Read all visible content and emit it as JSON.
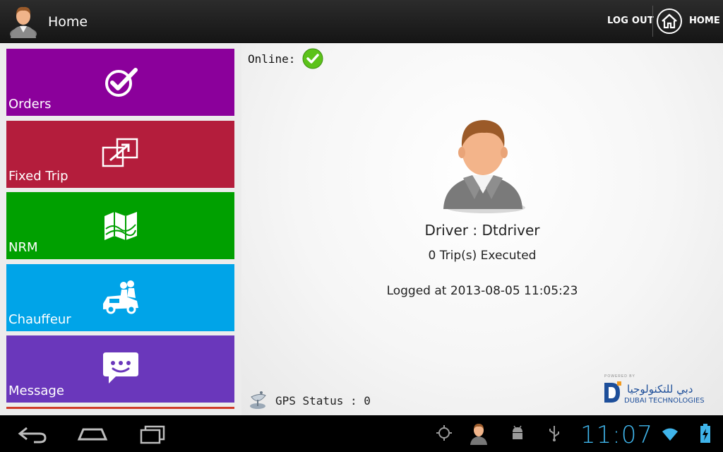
{
  "header": {
    "title": "Home",
    "logout_label": "LOG OUT",
    "home_label": "HOME"
  },
  "sidebar": {
    "tiles": [
      {
        "label": "Orders",
        "color": "#8b009b",
        "icon": "checkmark-icon"
      },
      {
        "label": "Fixed Trip",
        "color": "#b41d3c",
        "icon": "external-window-icon"
      },
      {
        "label": "NRM",
        "color": "#00a000",
        "icon": "map-icon"
      },
      {
        "label": "Chauffeur",
        "color": "#00a4e8",
        "icon": "car-passenger-icon"
      },
      {
        "label": "Message",
        "color": "#6a37bb",
        "icon": "chat-smile-icon"
      }
    ]
  },
  "main": {
    "online_label": "Online:",
    "driver": "Driver : Dtdriver",
    "trips": "0 Trip(s) Executed",
    "logged": "Logged at 2013-08-05 11:05:23",
    "gps_status": "GPS Status : 0",
    "brand": {
      "powered": "POWERED BY",
      "arabic": "دبي للتكنولوجيا",
      "english": "DUBAI TECHNOLOGIES"
    }
  },
  "system_bar": {
    "clock": "11:07"
  },
  "colors": {
    "accent_blue": "#3fb4ea",
    "online_green": "#5cc21a"
  }
}
